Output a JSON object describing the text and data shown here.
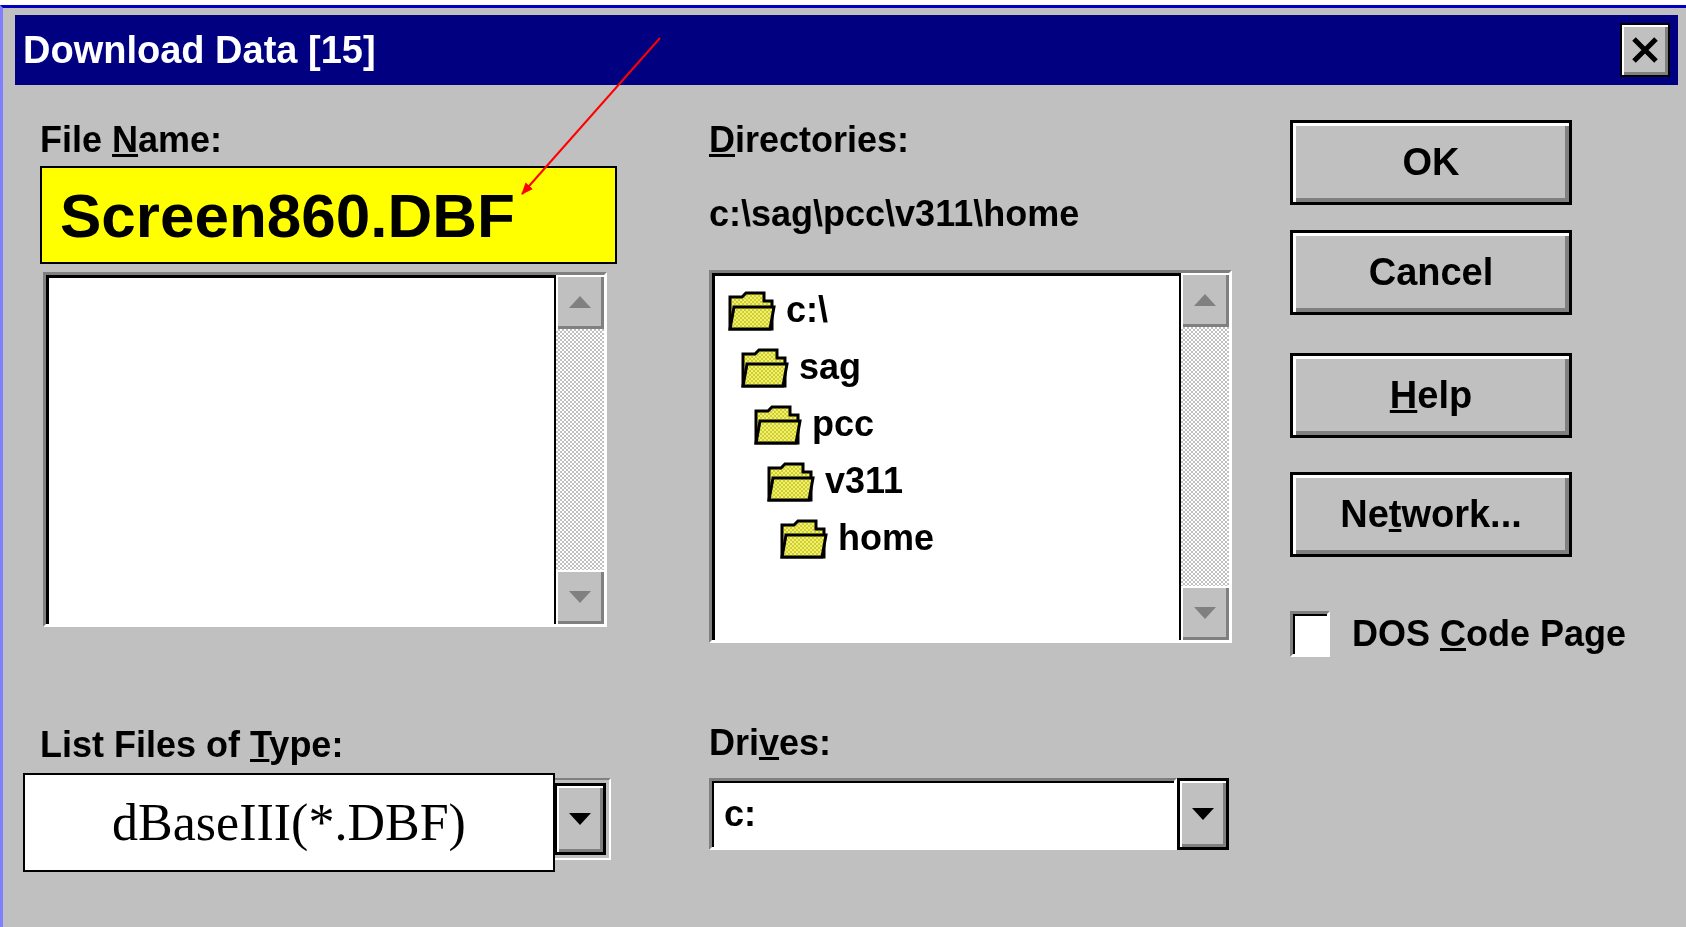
{
  "window": {
    "title": "Download Data [15]"
  },
  "file_name": {
    "label": {
      "before": "File ",
      "key": "N",
      "after": "ame:"
    },
    "value": "Screen860.DBF"
  },
  "directories": {
    "label": {
      "key": "D",
      "after": "irectories:"
    },
    "path": "c:\\sag\\pcc\\v311\\home",
    "tree": [
      {
        "name": "c:\\",
        "children": [
          {
            "name": "sag",
            "children": [
              {
                "name": "pcc",
                "children": [
                  {
                    "name": "v311",
                    "children": [
                      {
                        "name": "home"
                      }
                    ]
                  }
                ]
              }
            ]
          }
        ]
      }
    ]
  },
  "file_type": {
    "label": {
      "before": "List Files of ",
      "key": "T",
      "after": "ype:"
    },
    "value": "dBaseIII(*.DBF)"
  },
  "drives": {
    "label": {
      "before": "Dri",
      "key": "v",
      "after": "es:"
    },
    "value": "c:"
  },
  "buttons": [
    {
      "label": {
        "before": "OK"
      }
    },
    {
      "label": {
        "before": "Cancel"
      }
    },
    {
      "label": {
        "key": "H",
        "after": "elp"
      }
    },
    {
      "label": {
        "before": "Ne",
        "key": "t",
        "after": "work..."
      }
    }
  ],
  "dos_code_page": {
    "label": {
      "before": "DOS ",
      "key": "C",
      "after": "ode Page"
    },
    "checked": false
  }
}
